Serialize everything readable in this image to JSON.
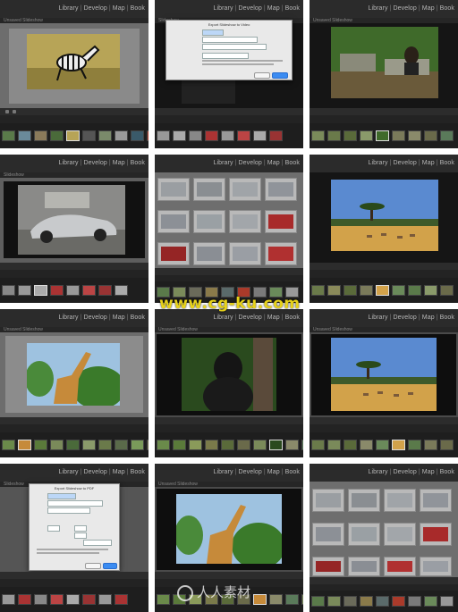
{
  "modules": {
    "library": "Library",
    "develop": "Develop",
    "map": "Map",
    "book": "Book",
    "sep": "|"
  },
  "watermark": {
    "text": "www.cg-ku.com",
    "site_name": "人人素材"
  },
  "colors": {
    "panel_bg": "#1b1b1b",
    "topbar": "#2b2b2b",
    "accent_blue": "#3b8cf2",
    "watermark_yellow": "#e7d21a"
  },
  "panels": [
    {
      "id": "p1",
      "scene": "zebra",
      "title": "Unsaved Slideshow"
    },
    {
      "id": "p2",
      "scene": "export-dialog",
      "title": "Slideshow",
      "dialog_title": "Export Slideshow to Video"
    },
    {
      "id": "p3",
      "scene": "monkey",
      "title": "Unsaved Slideshow"
    },
    {
      "id": "p4",
      "scene": "car",
      "title": "Slideshow"
    },
    {
      "id": "p5",
      "scene": "car-grid",
      "title": ""
    },
    {
      "id": "p6",
      "scene": "savanna",
      "title": ""
    },
    {
      "id": "p7",
      "scene": "giraffe",
      "title": "Unsaved Slideshow"
    },
    {
      "id": "p8",
      "scene": "gorilla",
      "title": "Unsaved Slideshow"
    },
    {
      "id": "p9",
      "scene": "savanna",
      "title": "Unsaved Slideshow"
    },
    {
      "id": "p10",
      "scene": "export-pdf-dialog",
      "title": "Slideshow",
      "dialog_title": "Export Slideshow to PDF"
    },
    {
      "id": "p11",
      "scene": "giraffe",
      "title": "Unsaved Slideshow"
    },
    {
      "id": "p12",
      "scene": "car-grid",
      "title": ""
    }
  ]
}
